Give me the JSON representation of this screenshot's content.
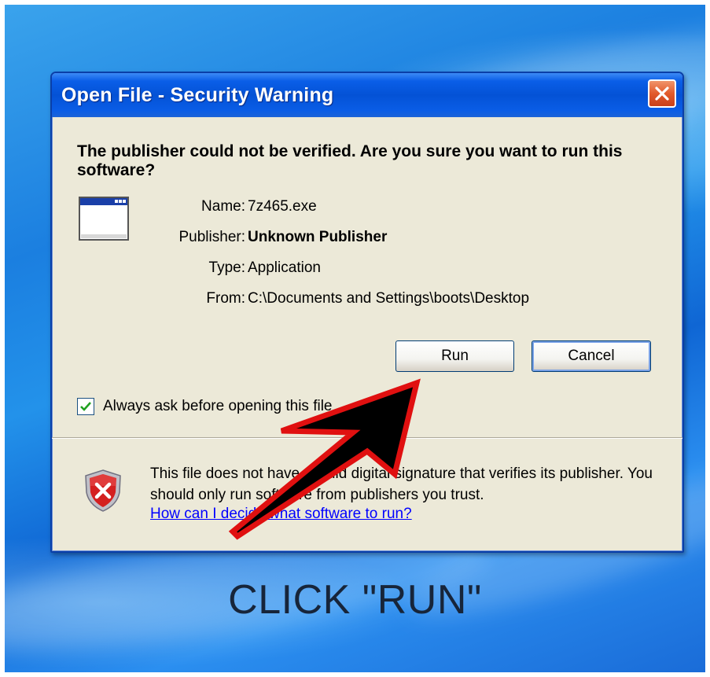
{
  "dialog": {
    "title": "Open File - Security Warning",
    "heading": "The publisher could not be verified.  Are you sure you want to run this software?",
    "fields": [
      {
        "label": "Name:",
        "value": "7z465.exe"
      },
      {
        "label": "Publisher:",
        "value": "Unknown Publisher"
      },
      {
        "label": "Type:",
        "value": "Application"
      },
      {
        "label": "From:",
        "value": "C:\\Documents and Settings\\boots\\Desktop"
      }
    ],
    "buttons": {
      "run": "Run",
      "cancel": "Cancel"
    },
    "checkbox": {
      "label": "Always ask before opening this file",
      "checked": true
    },
    "warning": {
      "text": "This file does not have a valid digital signature that verifies its publisher.  You should only run software from publishers you trust.",
      "link": "How can I decide what software to run?"
    },
    "icons": {
      "close": "close-icon",
      "application": "application-window-icon",
      "shield": "security-shield-icon",
      "arrow": "pointer-arrow-annotation"
    },
    "colors": {
      "titlebar": "#0452d6",
      "dialog_bg": "#ece9d8",
      "link": "#0000ff",
      "arrow_outline": "#e01010",
      "caption": "#17253a"
    }
  },
  "annotation": {
    "caption": "CLICK \"RUN\""
  }
}
